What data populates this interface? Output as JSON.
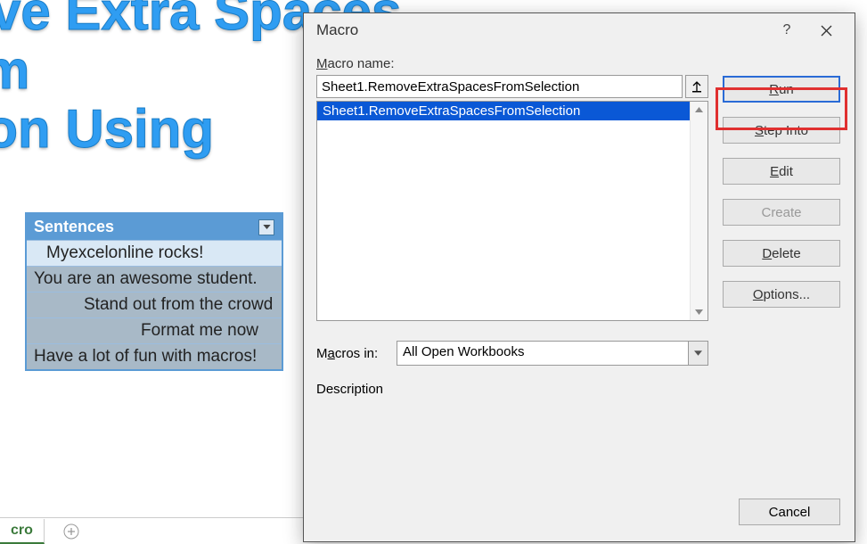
{
  "background": {
    "line1": "move Extra Spaces from",
    "line2": "ection Using"
  },
  "table": {
    "header": "Sentences",
    "rows": [
      "Myexcelonline rocks!",
      "You are an awesome student.",
      "Stand out from the crowd",
      "Format me now",
      "Have a lot of fun with macros!"
    ]
  },
  "sheet_tabs": {
    "active": "cro"
  },
  "dialog": {
    "title": "Macro",
    "macro_name_label": "Macro name:",
    "macro_name_value": "Sheet1.RemoveExtraSpacesFromSelection",
    "list_items": [
      "Sheet1.RemoveExtraSpacesFromSelection"
    ],
    "macros_in_label": "Macros in:",
    "macros_in_value": "All Open Workbooks",
    "description_label": "Description",
    "buttons": {
      "run": "Run",
      "step_into": "Step Into",
      "edit": "Edit",
      "create": "Create",
      "delete": "Delete",
      "options": "Options...",
      "cancel": "Cancel"
    },
    "help": "?"
  }
}
